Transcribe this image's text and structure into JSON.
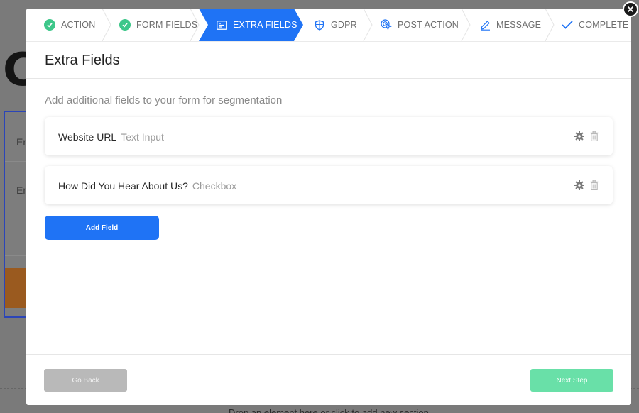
{
  "background": {
    "big_letter": "C",
    "field_placeholder_1": "En",
    "field_placeholder_2": "En",
    "drop_hint": "Drop an element here or click to add new section"
  },
  "steps": [
    {
      "label": "ACTION",
      "icon": "check-circle-icon",
      "state": "done"
    },
    {
      "label": "FORM FIELDS",
      "icon": "check-circle-icon",
      "state": "done"
    },
    {
      "label": "EXTRA FIELDS",
      "icon": "extra-fields-icon",
      "state": "active"
    },
    {
      "label": "GDPR",
      "icon": "shield-icon",
      "state": "pending"
    },
    {
      "label": "POST ACTION",
      "icon": "cursor-click-icon",
      "state": "pending"
    },
    {
      "label": "MESSAGE",
      "icon": "pencil-icon",
      "state": "pending"
    },
    {
      "label": "COMPLETE",
      "icon": "checkmark-icon",
      "state": "pending"
    }
  ],
  "modal": {
    "title": "Extra Fields",
    "subtitle": "Add additional fields to your form for segmentation",
    "fields": [
      {
        "name": "Website URL",
        "type": "Text Input"
      },
      {
        "name": "How Did You Hear About Us?",
        "type": "Checkbox"
      }
    ],
    "add_button": "Add Field",
    "back_button": "Go Back",
    "next_button": "Next Step"
  },
  "colors": {
    "accent": "#1f73f5",
    "done": "#3ec78a",
    "next": "#69e0a8",
    "back": "#b9b9b9"
  }
}
